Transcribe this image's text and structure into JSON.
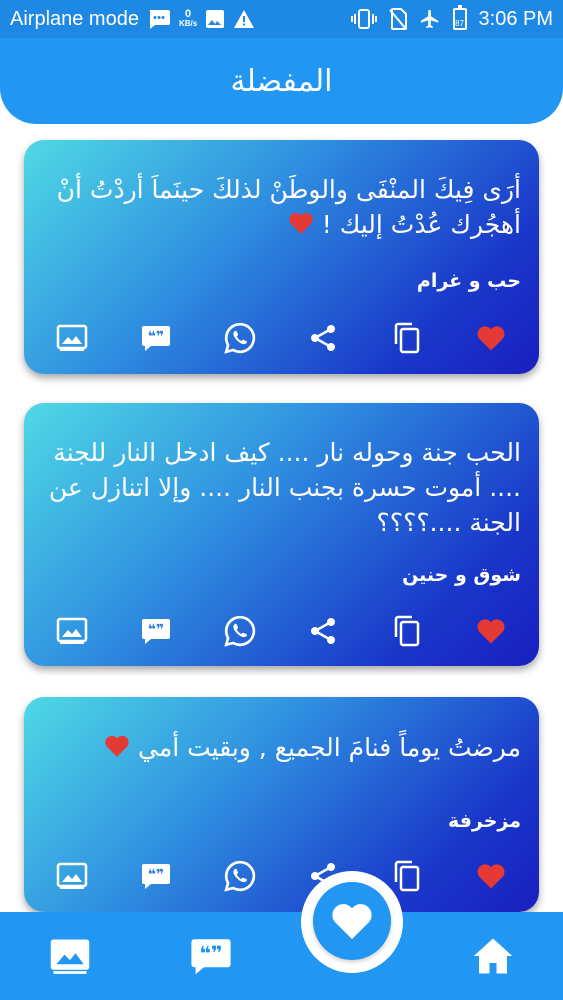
{
  "status": {
    "airplane": "Airplane mode",
    "net_value": "0",
    "net_unit": "KB/s",
    "battery": "87",
    "time": "3:06 PM"
  },
  "appbar": {
    "title": "المفضلة"
  },
  "cards": [
    {
      "text": "أرَى فِيكَ المنْفَى والوطَنْ لذلكَ حينَماَ أردْتُ أنْ أهجُرك عُدْتُ إليك !",
      "category": "حب و غرام"
    },
    {
      "text": "الحب جنة وحوله نار .... كيف ادخل النار للجنة .... أموت حسرة بجنب النار .... وإلا اتنازل عن الجنة ....؟؟؟؟",
      "category": "شوق و حنين"
    },
    {
      "text": "مرضتُ يوماً فنامَ الجميع , وبقيت أمي",
      "category": "مزخرفة"
    }
  ],
  "colors": {
    "primary": "#2196F3",
    "status": "#1E88E5",
    "heart": "#E53935"
  },
  "icons": [
    "image-icon",
    "quote-icon",
    "whatsapp-icon",
    "share-icon",
    "copy-icon",
    "heart-icon",
    "home-icon"
  ]
}
